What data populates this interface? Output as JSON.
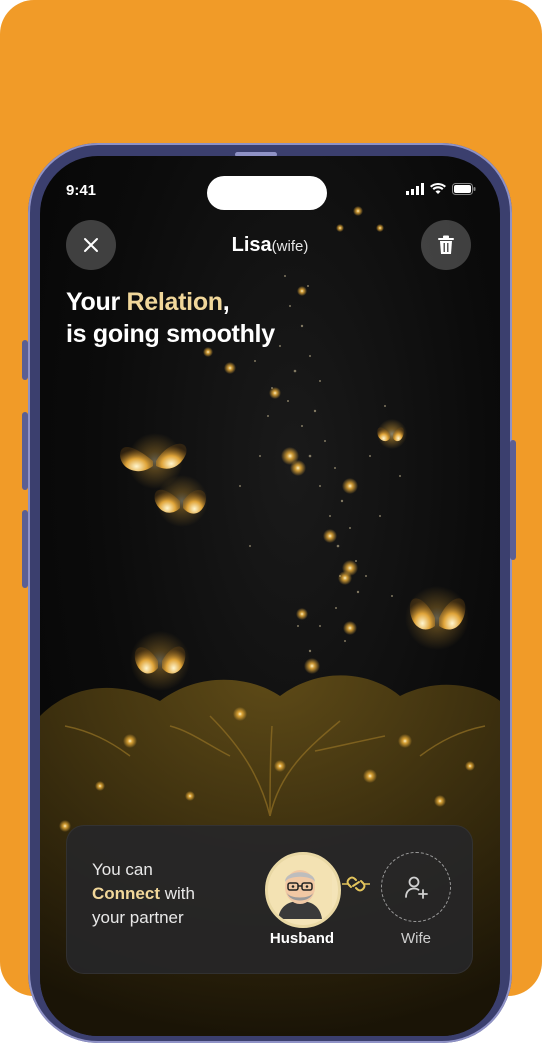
{
  "status_bar": {
    "time": "9:41"
  },
  "header": {
    "partner_name": "Lisa",
    "partner_role": "(wife)"
  },
  "headline": {
    "line1_prefix": "Your ",
    "line1_accent": "Relation",
    "line1_suffix": ",",
    "line2": "is going smoothly"
  },
  "connect_card": {
    "line1": "You can",
    "line2_accent": "Connect",
    "line2_rest": " with",
    "line3": "your partner",
    "husband_label": "Husband",
    "wife_label": "Wife"
  },
  "icons": [
    "close-icon",
    "trash-icon",
    "signal-icon",
    "wifi-icon",
    "battery-icon",
    "link-icon",
    "add-user-icon"
  ],
  "colors": {
    "background": "#F19B28",
    "accent": "#F1D79A",
    "screen": "#0b0b0b"
  }
}
